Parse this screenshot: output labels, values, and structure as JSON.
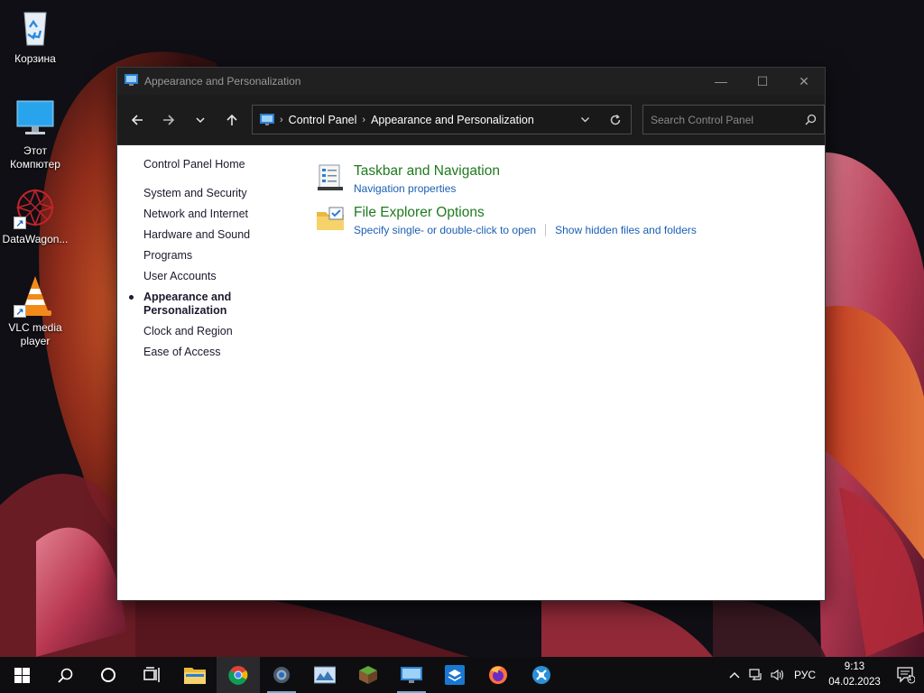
{
  "desktop": {
    "icons": [
      {
        "label": "Корзина",
        "icon": "recycle-bin-icon"
      },
      {
        "label": "Этот Компютер",
        "icon": "this-pc-icon"
      },
      {
        "label": "DataWagon...",
        "icon": "datawagon-icon"
      },
      {
        "label": "VLC media player",
        "icon": "vlc-icon"
      }
    ]
  },
  "window": {
    "title": "Appearance and Personalization",
    "controls": {
      "minimize": "—",
      "maximize": "☐",
      "close": "✕"
    }
  },
  "navbar": {
    "breadcrumb": [
      "Control Panel",
      "Appearance and Personalization"
    ],
    "search_placeholder": "Search Control Panel"
  },
  "sidebar": {
    "home": "Control Panel Home",
    "items": [
      {
        "label": "System and Security"
      },
      {
        "label": "Network and Internet"
      },
      {
        "label": "Hardware and Sound"
      },
      {
        "label": "Programs"
      },
      {
        "label": "User Accounts"
      },
      {
        "label": "Appearance and Personalization",
        "active": true
      },
      {
        "label": "Clock and Region"
      },
      {
        "label": "Ease of Access"
      }
    ]
  },
  "tasks": [
    {
      "heading": "Taskbar and Navigation",
      "links": [
        "Navigation properties"
      ],
      "icon": "taskbar-icon"
    },
    {
      "heading": "File Explorer Options",
      "links": [
        "Specify single- or double-click to open",
        "Show hidden files and folders"
      ],
      "icon": "folder-options-icon"
    }
  ],
  "taskbar": {
    "apps": [
      "start-icon",
      "search-icon",
      "cortana-icon",
      "task-view-icon",
      "file-explorer-icon",
      "chrome-icon",
      "settings-icon",
      "photos-icon",
      "minecraft-icon",
      "control-panel-icon",
      "stack-icon",
      "firefox-icon",
      "app-icon"
    ],
    "language": "РУС",
    "time": "9:13",
    "date": "04.02.2023",
    "notification_count": "1"
  }
}
